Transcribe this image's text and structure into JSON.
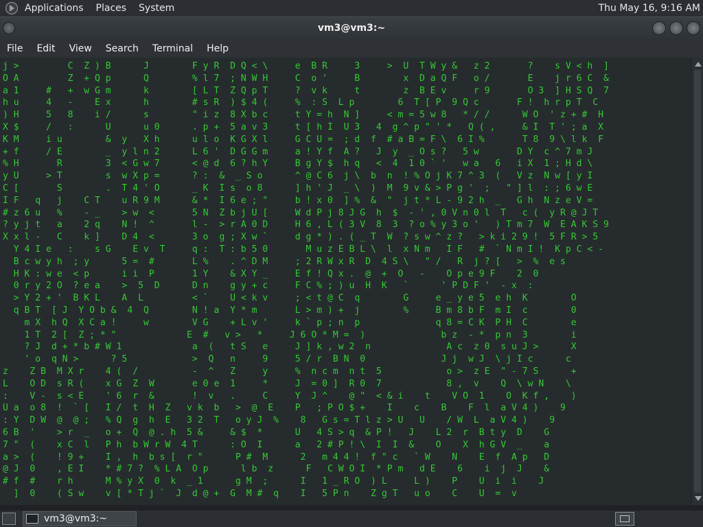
{
  "top_panel": {
    "menus": [
      "Applications",
      "Places",
      "System"
    ],
    "clock": "Thu May 16,  9:16 AM"
  },
  "window": {
    "title": "vm3@vm3:~"
  },
  "menubar": {
    "items": [
      "File",
      "Edit",
      "View",
      "Search",
      "Terminal",
      "Help"
    ]
  },
  "terminal": {
    "lines": [
      "j >         C  Z ) B      J        F y R  D Q < \\     e  B R     3     >  U  T W y &   z 2       ?    s V < h  ]",
      "O A         Z  + Q p      Q        % l 7  ; N W H     C  o '     B        x  D a Q F   o /       E    j r 6 C  &",
      "a 1     #   +  w G m      k        [ L T  Z Q p T     ?  v k     t        z  B E v     r 9       O 3  ] H S Q  7",
      "h u     4   -    E x      h        # s R  ) $ 4 (     %  : S  L p        6  T [ P  9 Q c       F !  h r p T  C",
      ") H     5   8    i /      s        \" i z  8 X b c     t Y = h  N ]     < m = 5 w 8   * / /      W O  ' z + #  H",
      "X $     /   :      U      u 0      . p +  5 a v 3     t [ h I  U 3   4  g ^ p \" ' *   Q ( ,     & I  T ' ; a  X",
      "K M     i u        &  y   X h      u l o  K G X l     G C U =  ; d  f  # a B = F \\  6 I %       T 8  9 \\ l k  F",
      "+ f     / E        _  y l n 2      L 6 '  D G G m     a ! Y f  A ?   J  y  _ O s ?   5 w       D Y  c ^ 7 m J",
      "% H       R        3  < G w 7      < @ d  6 ? h Y     B g Y $  h q   <  4  1 0 ` '   w a   6   i X  1 ; H d \\",
      "y U     > T        s  w X p =      ? :  &  _ S o      ^ @ C 6  j \\  b  n  ! % O j K 7 ^ 3  (   V z  N w [ y I",
      "C [       S        .  T 4 ' O      _ K  I s  o 8      ] h ' J  _ \\  )  M  9 v & > P g '  ;   \" ] l  : ; 6 w E",
      "I F   q   j    C T    u R 9 M      & *  I 6 e ; \"     b ! x 0  ] %  &  \"  j t * L - 9 2 h  _   G h  N z e V =",
      "# z 6 u   %    - _    > w  <       5 N  Z b j U [     W d P j 8 J G  h  $  - ' , 0 V n 0 l  T   c (  y R @ J T",
      "? y j t   a    2 q    N !  ^       l -  > r A 0 D     H 6 , L ( 3 V  8  3  ? o % y 3 o '   ) T m 7  W  E A K S 9",
      "X x l -   C    k ]    D 4  <       3 o  g ; X w `     d g * ) . ( _ T  W  ? s w ^ z ?   > k i 2 9 !  5 F R > 5",
      "  Y 4 I e   :    s G    E v  T     q :  T : b 5 0       M u z E B L \\  l  x N m   I F   #  ` N m I !  K p C < -",
      "  B c w y h  ; y      5 =  #       L %    . ^ D M     ; 2 R W x R  D  4 S \\   \" /   R  j ? [   >  %  e s",
      "  H K : w e  < p      i i  P       1 Y    & X Y _     E f ! Q x .  @  +  O   -    O p e 9 F    2  0",
      "  0 r y 2 O  ? e a    >  5  D      D n    g y + c     F C % ; ) u  H  K   `      ' P D F '  - x  :",
      "  > Y 2 + '  B K L    A  L         < `    U < k v     ; < t @ C  q        G     e _ y e 5  e h  K        O",
      "  q B T  [ J  Y O b &  4  Q        N ! a  Y * m       L > m ) +  j        %     B m 8 b F  m I  c        0",
      "    m X  h Q  X C a !     w        V G    + L v '     k ` p ; n  p              q 8 = C K  P H  C        e",
      "    1 T  2 [  Z ; * \"             E  #   v >   *     J 6 O * M =  )              b z  - *  p n  3        i",
      "    ? J  d + * b # W 1             a  (   t S   e     J ] k , w 2  n              A c  z 0  s u J >      X",
      "    ' o  q N >      ? 5            >  Q   n     9     5 / r  B N  0              J j  w J  \\ j I c      c",
      "z    Z B  M X r    4 (  /          -  ^   Z     y     %  n c m  n t  5            o >  z E  \" - 7 S      +",
      "L    O D  s R (    x G  Z  W       e 0 e  1     *     J  = 0 ]  R 0  7            8 ,  v    Q  \\ w N    \\",
      ":    V -  s < E    ' 6  r  &       !  v   .     C     Y  J ^    @ \"  < & i    t    V O  1    O  K f ,    )",
      "U a  o 8  !  ` [   I /  t  H  Z   v k  b   >  @  E    P   ; P O $ +    I    c    B    F  l  a V 4 )    9",
      ": Y  D W  @  @ ;   % Q  g  h  E   3 2  T   o y J  %    8   G s = T l z > U   U    / W  L  a V 4 )    9",
      "6 B  '    > r  _   o +  Q  @ . h  5 &     & $  *      U   4 S > q  & P !   J    L 2  r  B t y  D    G",
      "7 \"  (    x C  l   P h  b W r W  4 T      : O  I      a   2 # P ! \\  I  I  &    O    X  h G V  _    a",
      "a >  (    ! 9 +    I ,  h  b s [  r \"      P #  M      2   m 4 4 !  f \" c   ` W    N    E  f  A p   D",
      "@ J  0    , E I    * # 7 ?  % L A  O p      l b  z      F   C W O I  * P m   d E    6    i  j  J    &",
      "# f  #    r h      M % y X  0  k  _ 1      g M  ;      I   1 _ R O  ) L     L )    P    U  i  i    J",
      "  ]  0    ( S w    v [ * T j `  J  d @ +  G  M #  q    I   5 P n    Z g T   u o    C    U  =  v"
    ]
  },
  "taskbar": {
    "task_label": "vm3@vm3:~"
  },
  "colors": {
    "terminal_bg": "#262c2e",
    "terminal_fg": "#35c934",
    "panel_bg": "#2b2f33"
  }
}
